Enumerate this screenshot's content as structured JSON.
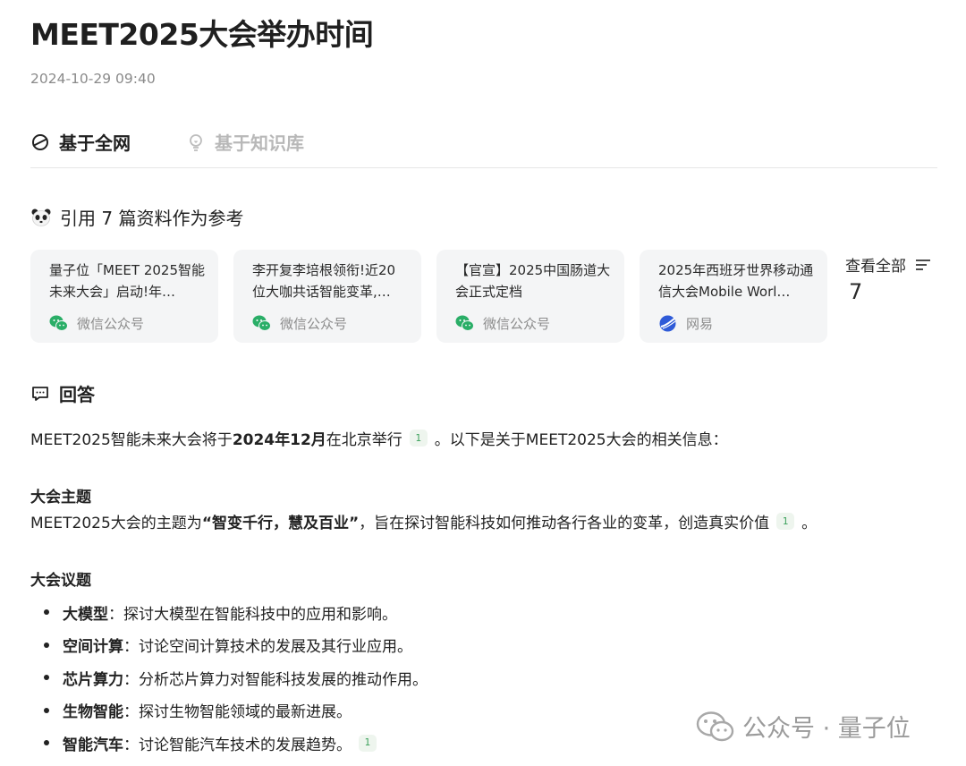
{
  "article": {
    "title": "MEET2025大会举办时间",
    "date": "2024-10-29 09:40"
  },
  "tabs": [
    {
      "label": "基于全网",
      "icon": "globe-icon",
      "active": true
    },
    {
      "label": "基于知识库",
      "icon": "lightbulb-icon",
      "active": false
    }
  ],
  "references": {
    "heading": "引用 7 篇资料作为参考",
    "cards": [
      {
        "title": "量子位「MEET 2025智能未来大会」启动!年…",
        "source": "微信公众号",
        "icon": "wechat-icon"
      },
      {
        "title": "李开复李培根领衔!近20位大咖共话智能变革,…",
        "source": "微信公众号",
        "icon": "wechat-icon"
      },
      {
        "title": "【官宣】2025中国肠道大会正式定档",
        "source": "微信公众号",
        "icon": "wechat-icon"
      },
      {
        "title": "2025年西班牙世界移动通信大会Mobile Worl…",
        "source": "网易",
        "icon": "netease-icon"
      }
    ],
    "view_all_label": "查看全部",
    "view_all_count": "7"
  },
  "answer": {
    "heading": "回答",
    "intro": {
      "pre": "MEET2025智能未来大会将于",
      "bold": "2024年12月",
      "post": "在北京举行",
      "cite": "1",
      "tail": "。以下是关于MEET2025大会的相关信息："
    },
    "theme": {
      "heading": "大会主题",
      "pre": "MEET2025大会的主题为",
      "bold": "“智变千行，慧及百业”",
      "post": "，旨在探讨智能科技如何推动各行各业的变革，创造真实价值",
      "cite": "1",
      "tail": "。"
    },
    "topics": {
      "heading": "大会议题",
      "items": [
        {
          "term": "大模型",
          "desc": "：探讨大模型在智能科技中的应用和影响。",
          "cite": ""
        },
        {
          "term": "空间计算",
          "desc": "：讨论空间计算技术的发展及其行业应用。",
          "cite": ""
        },
        {
          "term": "芯片算力",
          "desc": "：分析芯片算力对智能科技发展的推动作用。",
          "cite": ""
        },
        {
          "term": "生物智能",
          "desc": "：探讨生物智能领域的最新进展。",
          "cite": ""
        },
        {
          "term": "智能汽车",
          "desc": "：讨论智能汽车技术的发展趋势。",
          "cite": "1"
        }
      ]
    }
  },
  "watermark": {
    "text": "公众号 · 量子位"
  },
  "colors": {
    "cite_bg": "#eef5ee",
    "cite_text": "#3aa05a",
    "wechat_green": "#2aae67",
    "netease_blue": "#2f5bd8",
    "card_bg": "#f4f5f6"
  }
}
